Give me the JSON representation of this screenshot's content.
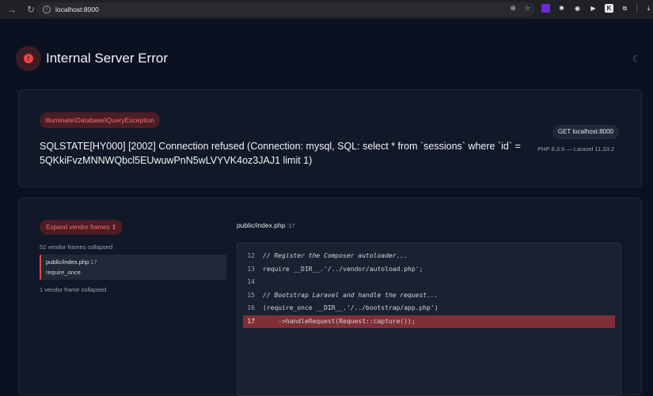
{
  "browser": {
    "url": "localhost:8000"
  },
  "header": {
    "title": "Internal Server Error"
  },
  "exception": {
    "class": "Illuminate\\Database\\QueryException",
    "message": "SQLSTATE[HY000] [2002] Connection refused (Connection: mysql, SQL: select * from `sessions` where `id` = 5QKkiFvzMNNWQbcl5EUwuwPnN5wLVYVK4oz3JAJ1 limit 1)",
    "request": "GET localhost:8000",
    "versions": "PHP 8.3.9 — Laravel 11.33.2"
  },
  "trace": {
    "expand_label": "Expand vendor frames",
    "collapsed_top": "52 vendor frames collapsed",
    "frame_file": "public/index.php",
    "frame_line": ":17",
    "frame_call": "require_once",
    "collapsed_bottom": "1 vendor frame collapsed"
  },
  "code": {
    "file": "public/index.php",
    "line": ":17",
    "lines": [
      {
        "n": "12",
        "text": "// Register the Composer autoloader..."
      },
      {
        "n": "13",
        "text": "require __DIR__.'/../vendor/autoload.php';"
      },
      {
        "n": "14",
        "text": ""
      },
      {
        "n": "15",
        "text": "// Bootstrap Laravel and handle the request..."
      },
      {
        "n": "16",
        "text": "(require_once __DIR__.'/../bootstrap/app.php')"
      },
      {
        "n": "17",
        "text": "    ->handleRequest(Request::capture());"
      }
    ]
  }
}
